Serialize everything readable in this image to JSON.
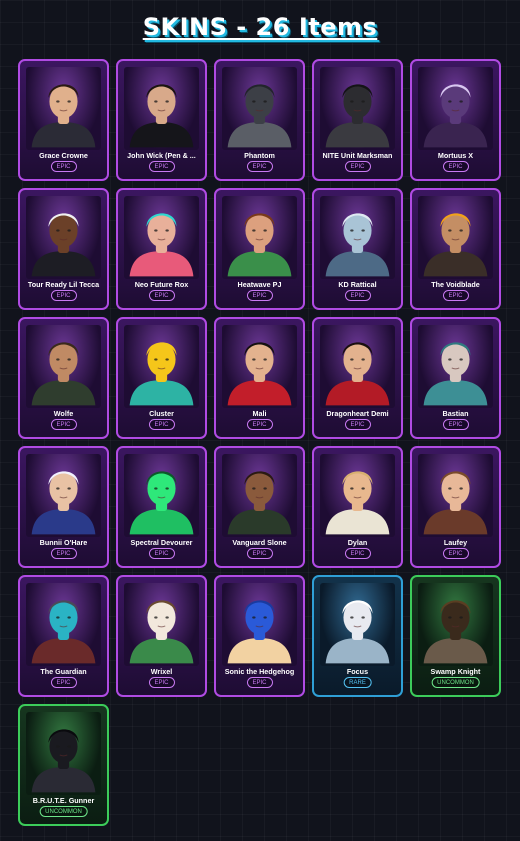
{
  "header": {
    "title": "SKINS - 26 Items"
  },
  "rarity_colors": {
    "EPIC": "#b04be3",
    "RARE": "#2f9fd6",
    "UNCOMMON": "#3ccc5a"
  },
  "skins": [
    {
      "name": "Grace Crowne",
      "rarity": "EPIC",
      "icon": "grace-crowne-portrait-icon"
    },
    {
      "name": "John Wick (Pen & ...",
      "rarity": "EPIC",
      "icon": "john-wick-portrait-icon"
    },
    {
      "name": "Phantom",
      "rarity": "EPIC",
      "icon": "phantom-portrait-icon"
    },
    {
      "name": "NITE Unit Marksman",
      "rarity": "EPIC",
      "icon": "nite-unit-marksman-portrait-icon"
    },
    {
      "name": "Mortuus X",
      "rarity": "EPIC",
      "icon": "mortuus-x-portrait-icon"
    },
    {
      "name": "Tour Ready Lil Tecca",
      "rarity": "EPIC",
      "icon": "tour-ready-lil-tecca-portrait-icon"
    },
    {
      "name": "Neo Future Rox",
      "rarity": "EPIC",
      "icon": "neo-future-rox-portrait-icon"
    },
    {
      "name": "Heatwave PJ",
      "rarity": "EPIC",
      "icon": "heatwave-pj-portrait-icon"
    },
    {
      "name": "KD Rattical",
      "rarity": "EPIC",
      "icon": "kd-rattical-portrait-icon"
    },
    {
      "name": "The Voidblade",
      "rarity": "EPIC",
      "icon": "the-voidblade-portrait-icon"
    },
    {
      "name": "Wolfe",
      "rarity": "EPIC",
      "icon": "wolfe-portrait-icon"
    },
    {
      "name": "Cluster",
      "rarity": "EPIC",
      "icon": "cluster-duck-portrait-icon"
    },
    {
      "name": "Mali",
      "rarity": "EPIC",
      "icon": "mali-portrait-icon"
    },
    {
      "name": "Dragonheart Demi",
      "rarity": "EPIC",
      "icon": "dragonheart-demi-portrait-icon"
    },
    {
      "name": "Bastian",
      "rarity": "EPIC",
      "icon": "bastian-portrait-icon"
    },
    {
      "name": "Bunnii O'Hare",
      "rarity": "EPIC",
      "icon": "bunnii-ohare-portrait-icon"
    },
    {
      "name": "Spectral Devourer",
      "rarity": "EPIC",
      "icon": "spectral-devourer-portrait-icon"
    },
    {
      "name": "Vanguard Slone",
      "rarity": "EPIC",
      "icon": "vanguard-slone-portrait-icon"
    },
    {
      "name": "Dylan",
      "rarity": "EPIC",
      "icon": "dylan-portrait-icon"
    },
    {
      "name": "Laufey",
      "rarity": "EPIC",
      "icon": "laufey-portrait-icon"
    },
    {
      "name": "The Guardian",
      "rarity": "EPIC",
      "icon": "the-guardian-portrait-icon"
    },
    {
      "name": "Wrixel",
      "rarity": "EPIC",
      "icon": "wrixel-block-portrait-icon"
    },
    {
      "name": "Sonic the Hedgehog",
      "rarity": "EPIC",
      "icon": "sonic-the-hedgehog-portrait-icon"
    },
    {
      "name": "Focus",
      "rarity": "RARE",
      "icon": "focus-portrait-icon"
    },
    {
      "name": "Swamp Knight",
      "rarity": "UNCOMMON",
      "icon": "swamp-knight-portrait-icon"
    },
    {
      "name": "B.R.U.T.E. Gunner",
      "rarity": "UNCOMMON",
      "icon": "brute-gunner-portrait-icon"
    }
  ]
}
